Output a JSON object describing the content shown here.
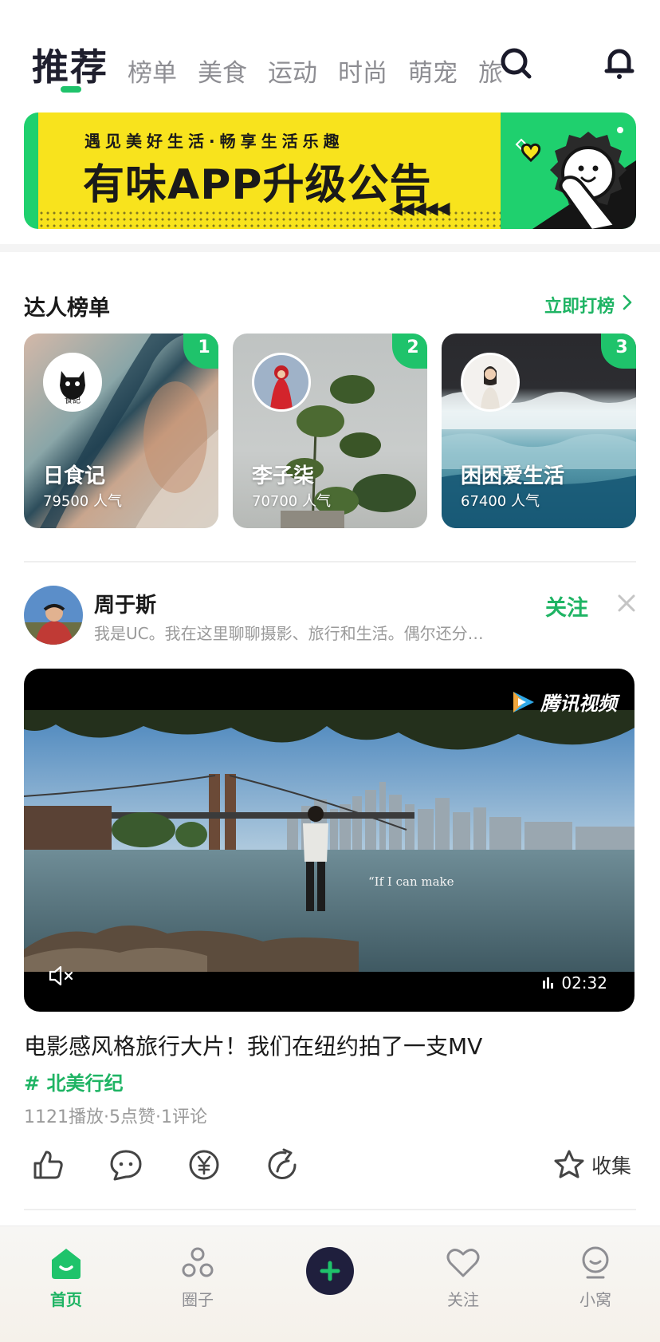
{
  "header": {
    "active_tab": "推荐",
    "tabs": [
      "榜单",
      "美食",
      "运动",
      "时尚",
      "萌宠",
      "旅"
    ]
  },
  "banner": {
    "subtitle": "遇见美好生活·畅享生活乐趣",
    "title": "有味APP升级公告",
    "arrows": "◀◀◀◀◀"
  },
  "ranking": {
    "title": "达人榜单",
    "more_label": "立即打榜",
    "cards": [
      {
        "rank": "1",
        "name": "日食记",
        "popularity": "79500 人气"
      },
      {
        "rank": "2",
        "name": "李子柒",
        "popularity": "70700 人气"
      },
      {
        "rank": "3",
        "name": "困困爱生活",
        "popularity": "67400 人气"
      }
    ]
  },
  "post": {
    "author": "周于斯",
    "bio": "我是UC。我在这里聊聊摄影、旅行和生活。偶尔还分…",
    "follow_label": "关注",
    "video": {
      "logo": "腾讯视频",
      "duration": "02:32",
      "caption": "“If I can make"
    },
    "title": "电影感风格旅行大片！我们在纽约拍了一支MV",
    "tag": "# 北美行纪",
    "stats": "1121播放·5点赞·1评论",
    "collect_label": "收集"
  },
  "bottom_nav": {
    "items": [
      {
        "label": "首页"
      },
      {
        "label": "圈子"
      },
      {
        "label": "关注"
      },
      {
        "label": "小窝"
      }
    ]
  },
  "colors": {
    "brand_green": "#1fc36b",
    "dark_navy": "#1f1f3d",
    "banner_yellow": "#f8e31d"
  }
}
